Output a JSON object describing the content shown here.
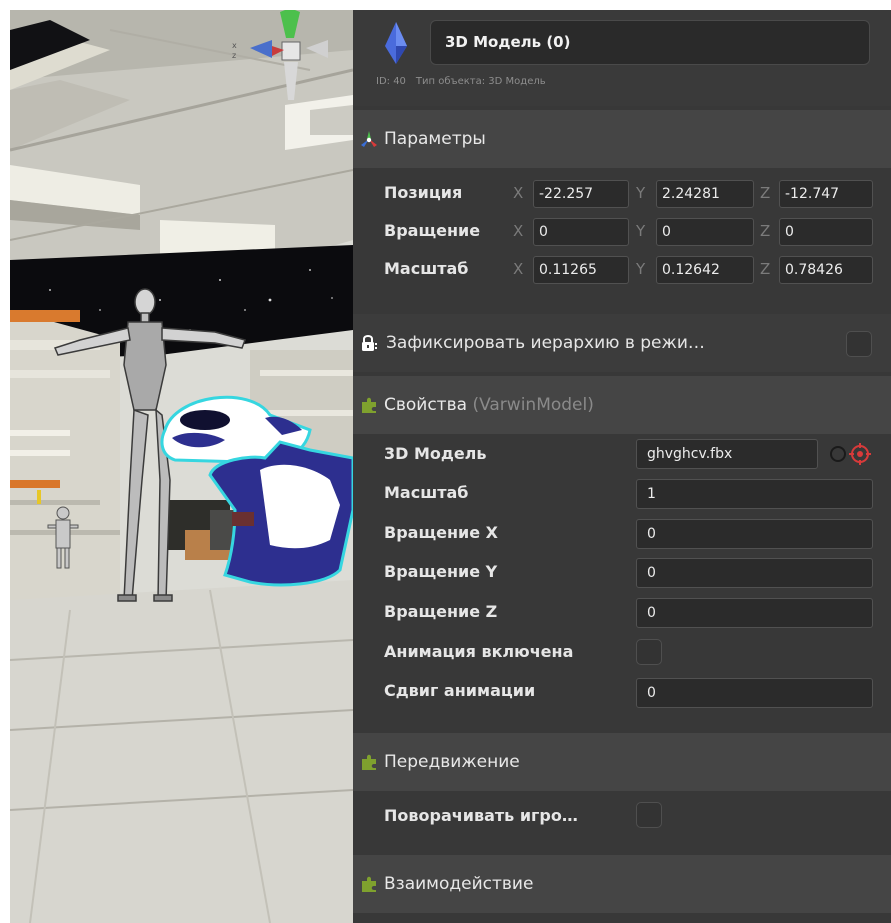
{
  "object": {
    "name": "3D Модель (0)",
    "id_text": "ID: 40",
    "type_text": "Тип объекта: 3D Модель"
  },
  "parameters": {
    "title": "Параметры",
    "rows": [
      {
        "label": "Позиция",
        "x": "-22.257",
        "y": "2.24281",
        "z": "-12.747"
      },
      {
        "label": "Вращение",
        "x": "0",
        "y": "0",
        "z": "0"
      },
      {
        "label": "Масштаб",
        "x": "0.11265",
        "y": "0.12642",
        "z": "0.78426"
      }
    ],
    "axis_labels": {
      "x": "X",
      "y": "Y",
      "z": "Z"
    }
  },
  "lock_hierarchy": {
    "label": "Зафиксировать иерархию в режи…",
    "checked": false
  },
  "properties": {
    "title": "Свойства",
    "subtitle": "(VarwinModel)",
    "rows": [
      {
        "label": "3D Модель",
        "value": "ghvghcv.fbx"
      },
      {
        "label": "Масштаб",
        "value": "1"
      },
      {
        "label": "Вращение X",
        "value": "0"
      },
      {
        "label": "Вращение Y",
        "value": "0"
      },
      {
        "label": "Вращение Z",
        "value": "0"
      },
      {
        "label": "Анимация включена",
        "checked": false
      },
      {
        "label": "Сдвиг анимации",
        "value": "0"
      }
    ]
  },
  "movement": {
    "title": "Передвижение",
    "rows": [
      {
        "label": "Поворачивать игро…",
        "checked": false
      }
    ]
  },
  "interaction": {
    "title": "Взаимодействие"
  },
  "colors": {
    "panel_bg": "#383838",
    "section_bg": "#454545",
    "field_bg": "#2b2b2b",
    "accent_blue": "#3b5bd6",
    "puzzle_green": "#7fa12e",
    "target_red": "#d83a3a",
    "gizmo_green": "#4cc04c",
    "gizmo_red": "#c83c3c"
  },
  "icons": {
    "object": "diamond-icon",
    "parameters": "axes-icon",
    "lock": "lock-icon",
    "section": "puzzle-icon",
    "asset_picker": "target-icon",
    "asset_clear": "circle-icon"
  }
}
